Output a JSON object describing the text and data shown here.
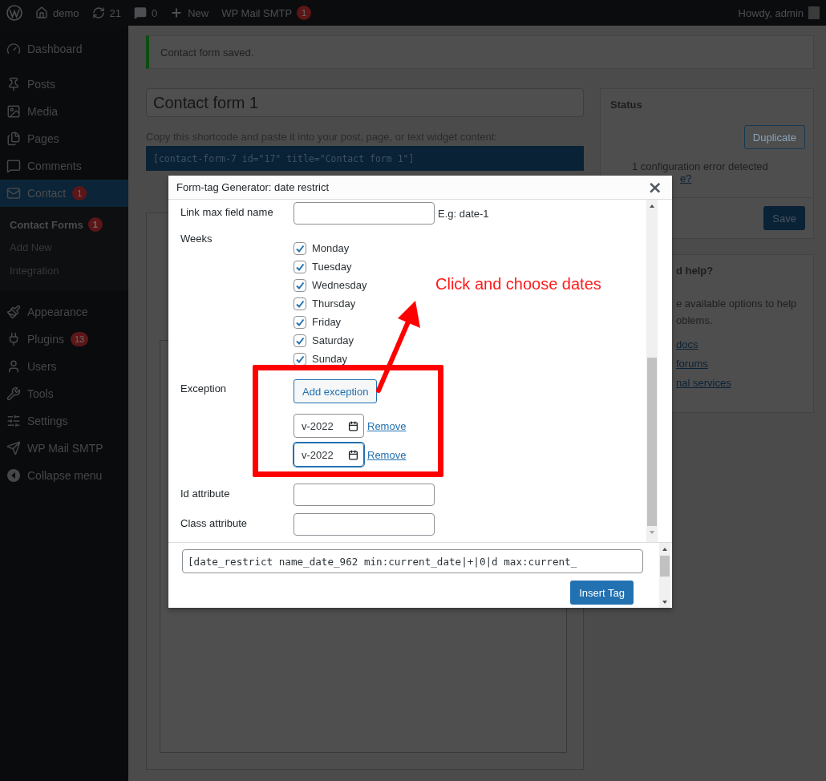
{
  "admin_bar": {
    "site": "demo",
    "updates": "21",
    "comments": "0",
    "new": "New",
    "plugin": {
      "label": "WP Mail SMTP",
      "badge": "1"
    },
    "greeting": "Howdy, admin"
  },
  "sidebar": {
    "items": [
      {
        "label": "Dashboard",
        "selected": false
      },
      {
        "label": "Posts",
        "selected": false
      },
      {
        "label": "Media",
        "selected": false
      },
      {
        "label": "Pages",
        "selected": false
      },
      {
        "label": "Comments",
        "selected": false
      },
      {
        "label": "Contact",
        "badge": "1",
        "selected": true,
        "children": [
          {
            "label": "Contact Forms",
            "badge": "1",
            "selected": true
          },
          {
            "label": "Add New",
            "selected": false
          },
          {
            "label": "Integration",
            "selected": false
          }
        ]
      },
      {
        "label": "Appearance",
        "selected": false
      },
      {
        "label": "Plugins",
        "badge": "13",
        "selected": false
      },
      {
        "label": "Users",
        "selected": false
      },
      {
        "label": "Tools",
        "selected": false
      },
      {
        "label": "Settings",
        "selected": false
      },
      {
        "label": "WP Mail SMTP",
        "selected": false
      }
    ],
    "collapse": "Collapse menu"
  },
  "notice": "Contact form saved.",
  "form_title": "Contact form 1",
  "shortcode_hint": "Copy this shortcode and paste it into your post, page, or text widget content:",
  "shortcode": "[contact-form-7 id=\"17\" title=\"Contact form 1\"]",
  "status_panel": {
    "title": "Status",
    "duplicate": "Duplicate",
    "error": "1 configuration error detected",
    "error_link": "e?",
    "save": "Save"
  },
  "help_panel": {
    "title": "d help?",
    "text_lines": [
      "e available options to help",
      "oblems."
    ],
    "links": [
      "docs",
      "forums",
      "nal services"
    ]
  },
  "modal": {
    "title": "Form-tag Generator: date restrict",
    "close": "×",
    "fields": [
      {
        "kind": "text",
        "label": "Link max field name",
        "hint": "E.g: date-1"
      },
      {
        "kind": "checkboxes",
        "label": "Weeks",
        "options": [
          {
            "label": "Monday",
            "checked": true
          },
          {
            "label": "Tuesday",
            "checked": true
          },
          {
            "label": "Wednesday",
            "checked": true
          },
          {
            "label": "Thursday",
            "checked": true
          },
          {
            "label": "Friday",
            "checked": true
          },
          {
            "label": "Saturday",
            "checked": true
          },
          {
            "label": "Sunday",
            "checked": true
          }
        ]
      },
      {
        "kind": "exceptions",
        "label": "Exception",
        "button": "Add exception",
        "dates": [
          {
            "value": "v-2022",
            "focused": false,
            "remove": "Remove"
          },
          {
            "value": "v-2022",
            "focused": true,
            "remove": "Remove"
          }
        ]
      },
      {
        "kind": "text",
        "label": "Id attribute"
      },
      {
        "kind": "text",
        "label": "Class attribute"
      }
    ],
    "tag": "[date_restrict name_date_962 min:current_date|+|0|d max:current_",
    "insert": "Insert Tag"
  },
  "annotation": {
    "text": "Click and choose dates"
  }
}
